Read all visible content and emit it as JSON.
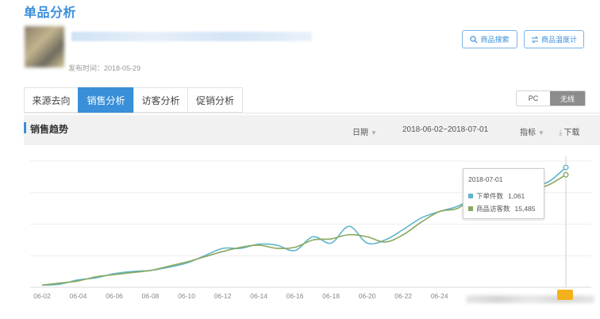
{
  "page": {
    "title": "单品分析"
  },
  "product": {
    "publish_time": "发布时间：2018-05-29"
  },
  "actions": {
    "search_label": "商品搜索",
    "compare_label": "商品温度计"
  },
  "tabs": [
    {
      "label": "来源去向",
      "active": false
    },
    {
      "label": "销售分析",
      "active": true
    },
    {
      "label": "访客分析",
      "active": false
    },
    {
      "label": "促销分析",
      "active": false
    }
  ],
  "device": {
    "pc_label": "PC",
    "wireless_label": "无线",
    "selected": "无线"
  },
  "section": {
    "title": "销售趋势",
    "date_label": "日期",
    "date_range": "2018-06-02~2018-07-01",
    "metric_label": "指标",
    "download_label": "下载"
  },
  "colors": {
    "accent": "#3a8fd9",
    "series_a": "#5fb4c9",
    "series_b": "#8aa85f"
  },
  "chart_data": {
    "type": "line",
    "x": [
      "06-02",
      "06-03",
      "06-04",
      "06-05",
      "06-06",
      "06-07",
      "06-08",
      "06-09",
      "06-10",
      "06-11",
      "06-12",
      "06-13",
      "06-14",
      "06-15",
      "06-16",
      "06-17",
      "06-18",
      "06-19",
      "06-20",
      "06-21",
      "06-22",
      "06-23",
      "06-24",
      "06-25",
      "06-26",
      "06-27",
      "06-28",
      "06-29",
      "06-30",
      "07-01"
    ],
    "tick_labels": [
      "06-02",
      "06-04",
      "06-06",
      "06-08",
      "06-10",
      "06-12",
      "06-14",
      "06-16",
      "06-18",
      "06-20",
      "06-22",
      "06-24"
    ],
    "ylim": [
      0,
      1.2
    ],
    "series": [
      {
        "name": "下单件数",
        "color": "#5fb4c9",
        "values": [
          0.02,
          0.03,
          0.07,
          0.09,
          0.13,
          0.15,
          0.16,
          0.19,
          0.23,
          0.3,
          0.37,
          0.37,
          0.41,
          0.4,
          0.35,
          0.48,
          0.42,
          0.58,
          0.42,
          0.45,
          0.55,
          0.66,
          0.72,
          0.77,
          0.85,
          0.9,
          0.94,
          0.96,
          1.0,
          1.14
        ]
      },
      {
        "name": "商品访客数",
        "color": "#8aa85f",
        "values": [
          0.02,
          0.04,
          0.06,
          0.1,
          0.12,
          0.14,
          0.16,
          0.2,
          0.24,
          0.29,
          0.34,
          0.38,
          0.4,
          0.37,
          0.38,
          0.45,
          0.46,
          0.5,
          0.48,
          0.43,
          0.5,
          0.62,
          0.72,
          0.75,
          0.86,
          0.88,
          0.9,
          0.93,
          0.97,
          1.07
        ]
      }
    ],
    "tooltip": {
      "date": "2018-07-01",
      "rows": [
        {
          "label": "下单件数",
          "value": "1,061"
        },
        {
          "label": "商品访客数",
          "value": "15,485"
        }
      ]
    }
  }
}
